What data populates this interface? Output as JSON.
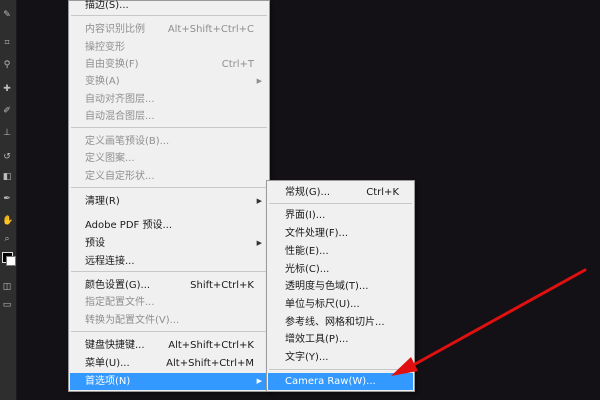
{
  "main_menu": {
    "items": [
      {
        "label": "描边(S)...",
        "shortcut": "",
        "disabled": false
      },
      {
        "label": "内容识别比例",
        "shortcut": "Alt+Shift+Ctrl+C",
        "disabled": true
      },
      {
        "label": "操控变形",
        "shortcut": "",
        "disabled": true
      },
      {
        "label": "自由变换(F)",
        "shortcut": "Ctrl+T",
        "disabled": true
      },
      {
        "label": "变换(A)",
        "shortcut": "",
        "disabled": true,
        "submenu": true
      },
      {
        "label": "自动对齐图层...",
        "shortcut": "",
        "disabled": true
      },
      {
        "label": "自动混合图层...",
        "shortcut": "",
        "disabled": true
      },
      {
        "label": "定义画笔预设(B)...",
        "shortcut": "",
        "disabled": true
      },
      {
        "label": "定义图案...",
        "shortcut": "",
        "disabled": true
      },
      {
        "label": "定义自定形状...",
        "shortcut": "",
        "disabled": true
      },
      {
        "label": "清理(R)",
        "shortcut": "",
        "disabled": false,
        "submenu": true
      },
      {
        "label": "Adobe PDF 预设...",
        "shortcut": "",
        "disabled": false
      },
      {
        "label": "预设",
        "shortcut": "",
        "disabled": false,
        "submenu": true
      },
      {
        "label": "远程连接...",
        "shortcut": "",
        "disabled": false
      },
      {
        "label": "颜色设置(G)...",
        "shortcut": "Shift+Ctrl+K",
        "disabled": false
      },
      {
        "label": "指定配置文件...",
        "shortcut": "",
        "disabled": true
      },
      {
        "label": "转换为配置文件(V)...",
        "shortcut": "",
        "disabled": true
      },
      {
        "label": "键盘快捷键...",
        "shortcut": "Alt+Shift+Ctrl+K",
        "disabled": false
      },
      {
        "label": "菜单(U)...",
        "shortcut": "Alt+Shift+Ctrl+M",
        "disabled": false
      },
      {
        "label": "首选项(N)",
        "shortcut": "",
        "disabled": false,
        "submenu": true,
        "highlight": true
      }
    ]
  },
  "sub_menu": {
    "items": [
      {
        "label": "常规(G)...",
        "shortcut": "Ctrl+K"
      },
      {
        "label": "界面(I)...",
        "shortcut": ""
      },
      {
        "label": "文件处理(F)...",
        "shortcut": ""
      },
      {
        "label": "性能(E)...",
        "shortcut": ""
      },
      {
        "label": "光标(C)...",
        "shortcut": ""
      },
      {
        "label": "透明度与色域(T)...",
        "shortcut": ""
      },
      {
        "label": "单位与标尺(U)...",
        "shortcut": ""
      },
      {
        "label": "参考线、网格和切片...",
        "shortcut": ""
      },
      {
        "label": "增效工具(P)...",
        "shortcut": ""
      },
      {
        "label": "文字(Y)...",
        "shortcut": ""
      },
      {
        "label": "Camera Raw(W)...",
        "shortcut": "",
        "highlight": true
      }
    ]
  },
  "colors": {
    "highlight": "#3399ff",
    "annotation": "#e01010",
    "canvas": "#131115"
  }
}
